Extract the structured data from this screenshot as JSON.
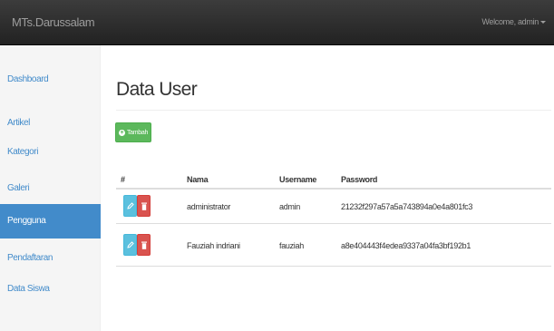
{
  "navbar": {
    "brand": "MTs.Darussalam",
    "welcome": "Welcome, admin"
  },
  "sidebar": {
    "items": [
      {
        "label": "Dashboard",
        "active": false
      },
      {
        "label": "Artikel",
        "active": false
      },
      {
        "label": "Kategori",
        "active": false
      },
      {
        "label": "Galeri",
        "active": false
      },
      {
        "label": "Pengguna",
        "active": true
      },
      {
        "label": "Pendaftaran",
        "active": false
      },
      {
        "label": "Data Siswa",
        "active": false
      }
    ]
  },
  "main": {
    "title": "Data User",
    "add_button": "Tambah",
    "table": {
      "headers": [
        "#",
        "Nama",
        "Username",
        "Password"
      ],
      "rows": [
        {
          "nama": "administrator",
          "username": "admin",
          "password": "21232f297a57a5a743894a0e4a801fc3"
        },
        {
          "nama": "Fauziah indriani",
          "username": "fauziah",
          "password": "a8e404443f4edea9337a04fa3bf192b1"
        }
      ]
    }
  },
  "colors": {
    "navbar": "#222222",
    "sidebar_active": "#428bca",
    "link": "#428bca",
    "add_button": "#5cb85c",
    "edit_button": "#5bc0de",
    "delete_button": "#d9534f"
  },
  "icons": {
    "add": "plus-circle-icon",
    "edit": "pencil-icon",
    "delete": "trash-icon"
  }
}
